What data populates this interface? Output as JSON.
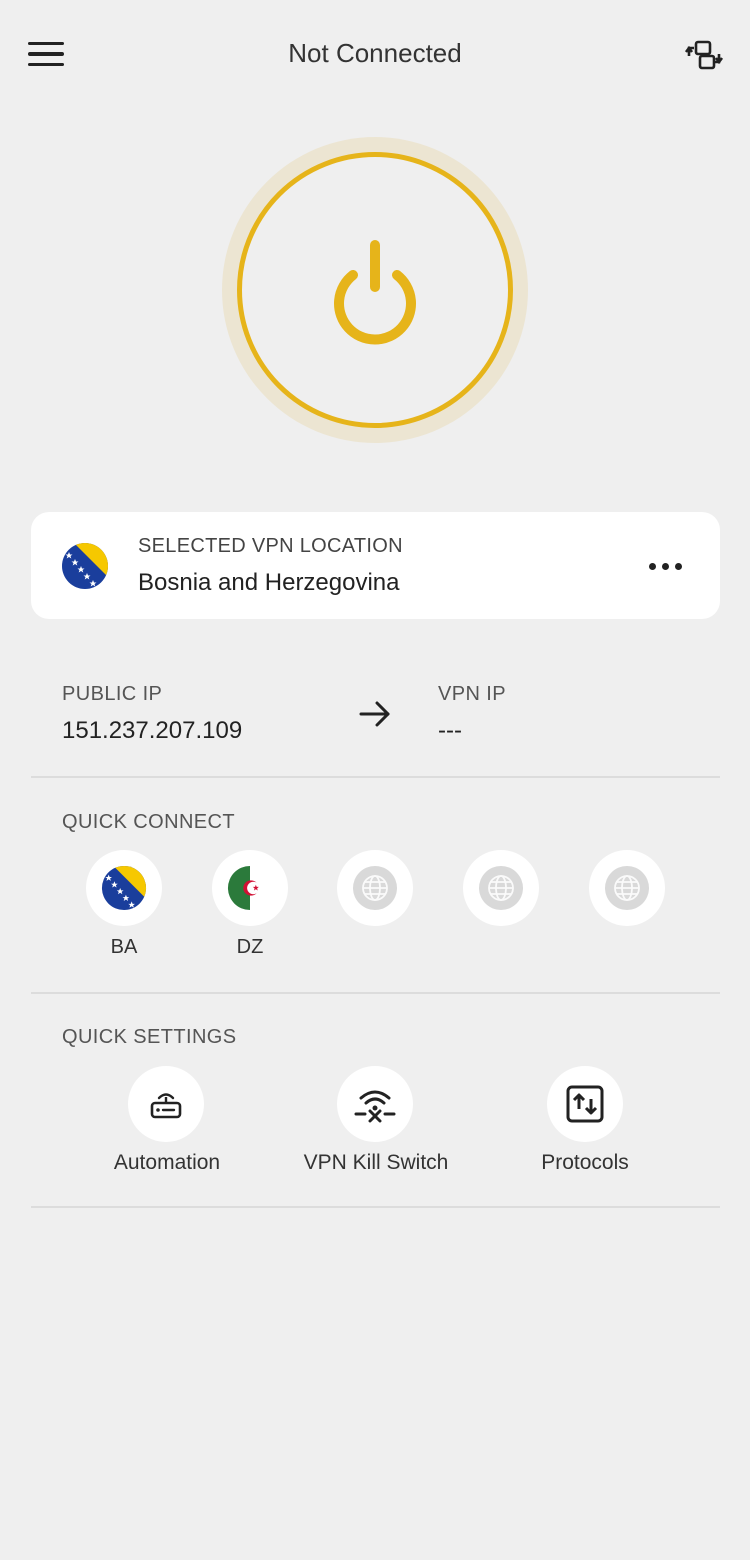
{
  "header": {
    "title": "Not Connected",
    "menu_icon": "hamburger-menu-icon",
    "right_icon": "switch-server-icon"
  },
  "power": {
    "state": "disconnected",
    "icon": "power-icon",
    "accent": "#e6b41a"
  },
  "selected_location": {
    "caption": "SELECTED VPN LOCATION",
    "name": "Bosnia and Herzegovina",
    "flag": "BA",
    "more_icon": "more-dots-icon"
  },
  "ip": {
    "public_label": "PUBLIC IP",
    "public_value": "151.237.207.109",
    "vpn_label": "VPN IP",
    "vpn_value": "---",
    "arrow_icon": "arrow-right-icon"
  },
  "quick_connect": {
    "label": "QUICK CONNECT",
    "items": [
      {
        "code": "BA",
        "icon": "flag-ba"
      },
      {
        "code": "DZ",
        "icon": "flag-dz"
      },
      {
        "code": "",
        "icon": "globe-icon"
      },
      {
        "code": "",
        "icon": "globe-icon"
      },
      {
        "code": "",
        "icon": "globe-icon"
      }
    ]
  },
  "quick_settings": {
    "label": "QUICK SETTINGS",
    "items": [
      {
        "label": "Automation",
        "icon": "router-icon"
      },
      {
        "label": "VPN Kill Switch",
        "icon": "wifi-off-icon"
      },
      {
        "label": "Protocols",
        "icon": "protocol-swap-icon"
      }
    ]
  }
}
